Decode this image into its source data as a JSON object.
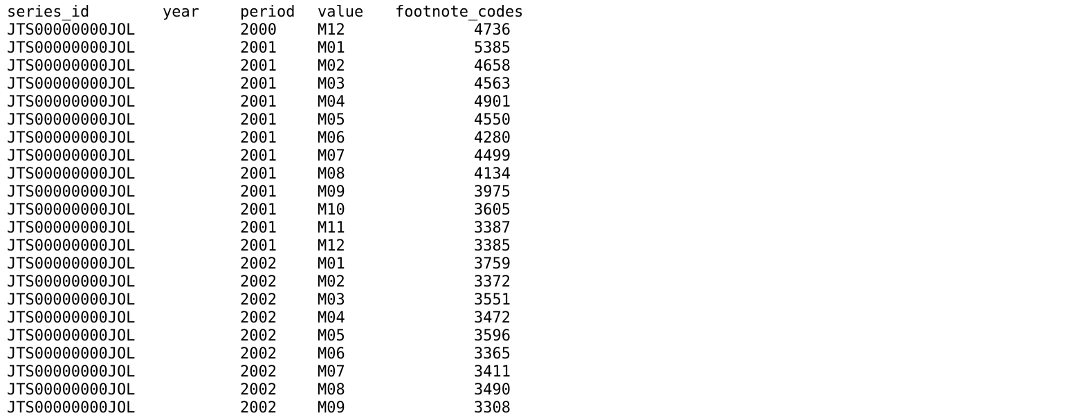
{
  "headers": {
    "series_id": "series_id",
    "year": "year",
    "period": "period",
    "value": "value",
    "footnote_codes": "footnote_codes"
  },
  "rows": [
    {
      "series_id": "JTS00000000JOL",
      "year": "2000",
      "period": "M12",
      "value": "4736"
    },
    {
      "series_id": "JTS00000000JOL",
      "year": "2001",
      "period": "M01",
      "value": "5385"
    },
    {
      "series_id": "JTS00000000JOL",
      "year": "2001",
      "period": "M02",
      "value": "4658"
    },
    {
      "series_id": "JTS00000000JOL",
      "year": "2001",
      "period": "M03",
      "value": "4563"
    },
    {
      "series_id": "JTS00000000JOL",
      "year": "2001",
      "period": "M04",
      "value": "4901"
    },
    {
      "series_id": "JTS00000000JOL",
      "year": "2001",
      "period": "M05",
      "value": "4550"
    },
    {
      "series_id": "JTS00000000JOL",
      "year": "2001",
      "period": "M06",
      "value": "4280"
    },
    {
      "series_id": "JTS00000000JOL",
      "year": "2001",
      "period": "M07",
      "value": "4499"
    },
    {
      "series_id": "JTS00000000JOL",
      "year": "2001",
      "period": "M08",
      "value": "4134"
    },
    {
      "series_id": "JTS00000000JOL",
      "year": "2001",
      "period": "M09",
      "value": "3975"
    },
    {
      "series_id": "JTS00000000JOL",
      "year": "2001",
      "period": "M10",
      "value": "3605"
    },
    {
      "series_id": "JTS00000000JOL",
      "year": "2001",
      "period": "M11",
      "value": "3387"
    },
    {
      "series_id": "JTS00000000JOL",
      "year": "2001",
      "period": "M12",
      "value": "3385"
    },
    {
      "series_id": "JTS00000000JOL",
      "year": "2002",
      "period": "M01",
      "value": "3759"
    },
    {
      "series_id": "JTS00000000JOL",
      "year": "2002",
      "period": "M02",
      "value": "3372"
    },
    {
      "series_id": "JTS00000000JOL",
      "year": "2002",
      "period": "M03",
      "value": "3551"
    },
    {
      "series_id": "JTS00000000JOL",
      "year": "2002",
      "period": "M04",
      "value": "3472"
    },
    {
      "series_id": "JTS00000000JOL",
      "year": "2002",
      "period": "M05",
      "value": "3596"
    },
    {
      "series_id": "JTS00000000JOL",
      "year": "2002",
      "period": "M06",
      "value": "3365"
    },
    {
      "series_id": "JTS00000000JOL",
      "year": "2002",
      "period": "M07",
      "value": "3411"
    },
    {
      "series_id": "JTS00000000JOL",
      "year": "2002",
      "period": "M08",
      "value": "3490"
    },
    {
      "series_id": "JTS00000000JOL",
      "year": "2002",
      "period": "M09",
      "value": "3308"
    }
  ]
}
